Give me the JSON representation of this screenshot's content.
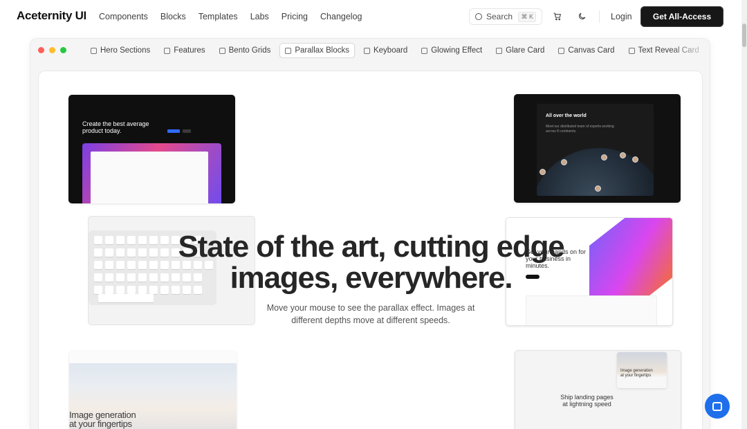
{
  "nav": {
    "logo": "Aceternity UI",
    "links": [
      "Components",
      "Blocks",
      "Templates",
      "Labs",
      "Pricing",
      "Changelog"
    ],
    "search_label": "Search",
    "search_shortcut": "⌘ K",
    "login": "Login",
    "cta": "Get All-Access",
    "icons": [
      "cart-icon",
      "moon-icon"
    ]
  },
  "window": {
    "dot_colors": [
      "#ff5f57",
      "#febc2e",
      "#28c840"
    ],
    "tabs": [
      {
        "label": "Hero Sections",
        "icon": "hero-icon",
        "active": false
      },
      {
        "label": "Features",
        "icon": "features-icon",
        "active": false
      },
      {
        "label": "Bento Grids",
        "icon": "bento-icon",
        "active": false
      },
      {
        "label": "Parallax Blocks",
        "icon": "parallax-icon",
        "active": true
      },
      {
        "label": "Keyboard",
        "icon": "keyboard-icon",
        "active": false
      },
      {
        "label": "Glowing Effect",
        "icon": "glow-icon",
        "active": false
      },
      {
        "label": "Glare Card",
        "icon": "glare-icon",
        "active": false
      },
      {
        "label": "Canvas Card",
        "icon": "canvas-icon",
        "active": false
      },
      {
        "label": "Text Reveal Card",
        "icon": "text-reveal-icon",
        "active": false
      }
    ]
  },
  "hero": {
    "title_line1": "State of the art, cutting edge",
    "title_line2": "images, everywhere.",
    "subtitle": "Move your mouse to see the parallax effect. Images at different depths move at different speeds."
  },
  "cards": {
    "card1_heading_line1": "Create the best average",
    "card1_heading_line2": "product today.",
    "card2_title": "All over the world",
    "card2_text": "Meet our distributed team of experts working across 8 continents.",
    "card4_heading": "Get your hands on for your business in minutes.",
    "card5_line1": "Image generation",
    "card5_line2": "at your fingertips",
    "card6_img_line1": "Image generation",
    "card6_img_line2": "at your fingertips",
    "card6_line1": "Ship landing pages",
    "card6_line2": "at lightning speed"
  },
  "colors": {
    "cta_bg": "#171717",
    "chat_bg": "#1f6feb"
  }
}
